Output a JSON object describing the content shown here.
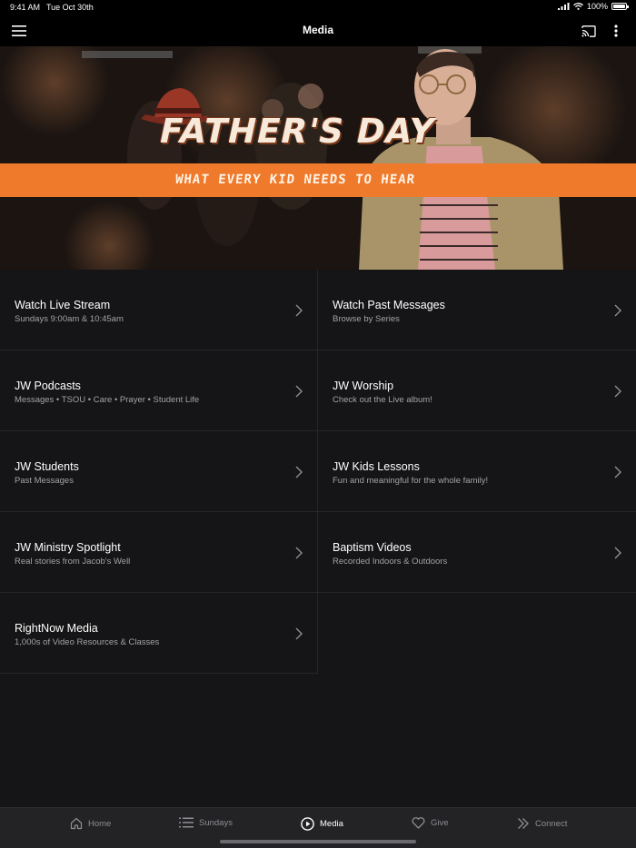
{
  "status": {
    "time": "9:41 AM",
    "date": "Tue Oct 30th",
    "battery": "100%"
  },
  "navbar": {
    "title": "Media",
    "menu_icon": "hamburger-icon",
    "cast_icon": "cast-icon",
    "more_icon": "more-vertical-icon"
  },
  "hero": {
    "title": "FATHER'S DAY",
    "subtitle": "WHAT EVERY KID NEEDS TO HEAR",
    "accent": "#f07a2c"
  },
  "items": [
    {
      "label": "Watch Live Stream",
      "sub": "Sundays 9:00am & 10:45am"
    },
    {
      "label": "Watch Past Messages",
      "sub": "Browse by Series"
    },
    {
      "label": "JW Podcasts",
      "sub": "Messages • TSOU • Care • Prayer • Student Life"
    },
    {
      "label": "JW Worship",
      "sub": "Check out the Live album!"
    },
    {
      "label": "JW Students",
      "sub": "Past Messages"
    },
    {
      "label": "JW Kids Lessons",
      "sub": "Fun and meaningful for the whole family!"
    },
    {
      "label": "JW Ministry Spotlight",
      "sub": "Real stories from Jacob's Well"
    },
    {
      "label": "Baptism Videos",
      "sub": "Recorded Indoors & Outdoors"
    },
    {
      "label": "RightNow Media",
      "sub": "1,000s of Video Resources & Classes"
    }
  ],
  "tabs": [
    {
      "label": "Home",
      "icon": "home-icon"
    },
    {
      "label": "Sundays",
      "icon": "list-icon"
    },
    {
      "label": "Media",
      "icon": "play-circle-icon"
    },
    {
      "label": "Give",
      "icon": "heart-icon"
    },
    {
      "label": "Connect",
      "icon": "double-chevron-icon"
    }
  ],
  "active_tab": "Media"
}
